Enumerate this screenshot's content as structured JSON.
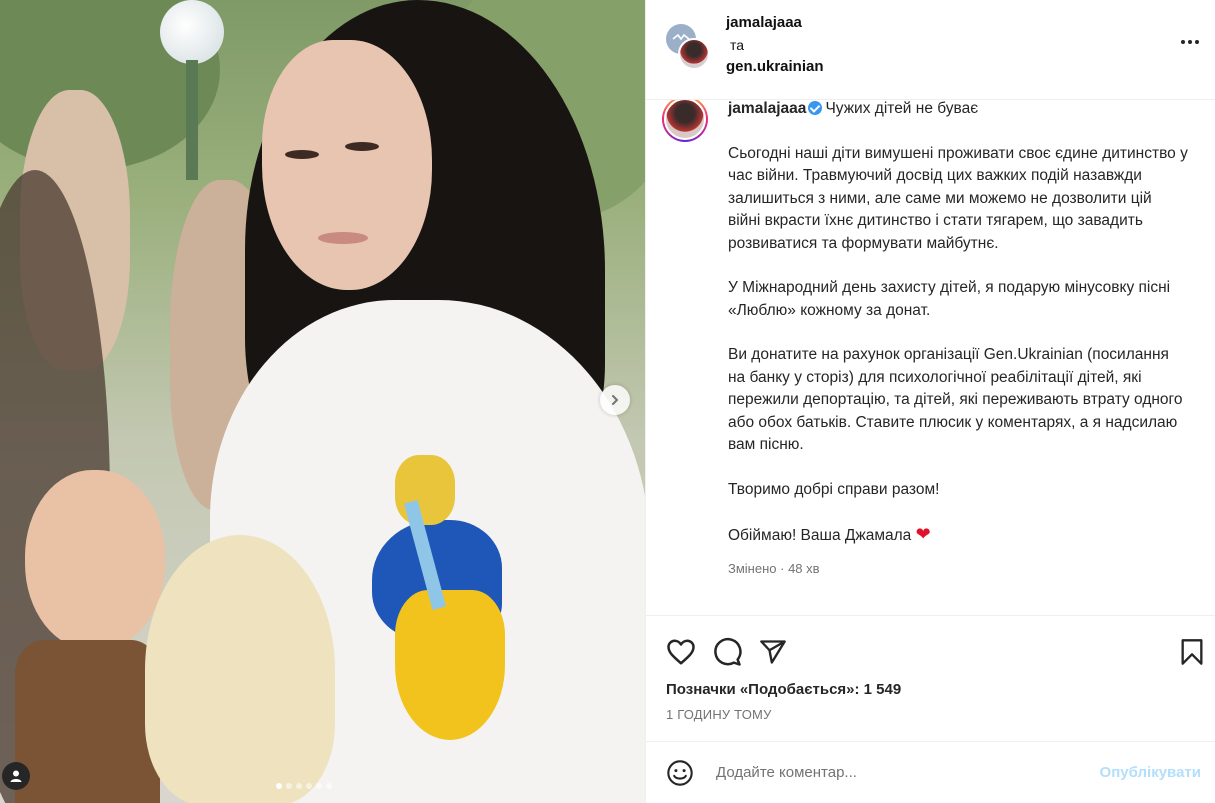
{
  "header": {
    "username_primary": "jamalajaaa",
    "joiner": "та",
    "username_secondary": "gen.ukrainian"
  },
  "caption": {
    "username": "jamalajaaa",
    "title": "Чужих дітей не буває",
    "paragraphs": [
      "Сьогодні наші діти вимушені проживати своє єдине дитинство у час війни. Травмуючий досвід цих важких подій назавжди залишиться з ними, але саме ми можемо не дозволити цій війні вкрасти їхнє дитинство і стати тягарем, що завадить розвиватися та формувати майбутнє.",
      "У Міжнародний день захисту дітей, я подарую мінусовку пісні «Люблю» кожному за донат.",
      "Ви донатите на рахунок організації Gen.Ukrainian (посилання на банку у сторіз) для психологічної реабілітації дітей, які пережили депортацію, та дітей, які переживають втрату одного або обох батьків. Ставите плюсик у коментарях, а я надсилаю вам пісню.",
      "Творимо добрі справи разом!",
      "Обіймаю! Ваша Джамала"
    ],
    "edited_label": "Змінено",
    "edited_time": "48 хв"
  },
  "likes_text": "Позначки «Подобається»: 1 549",
  "timestamp": "1 ГОДИНУ ТОМУ",
  "comment": {
    "placeholder": "Додайте коментар...",
    "post_label": "Опублікувати"
  },
  "carousel": {
    "total_slides": 6,
    "active_slide": 1
  },
  "colors": {
    "verified": "#3897f0",
    "post_disabled": "#b2dffc",
    "heart_red": "#e0112b"
  },
  "icons": [
    "heart-icon",
    "comment-icon",
    "share-icon",
    "bookmark-icon",
    "emoji-icon",
    "more-icon",
    "chevron-right-icon",
    "user-tag-icon",
    "verified-icon"
  ]
}
